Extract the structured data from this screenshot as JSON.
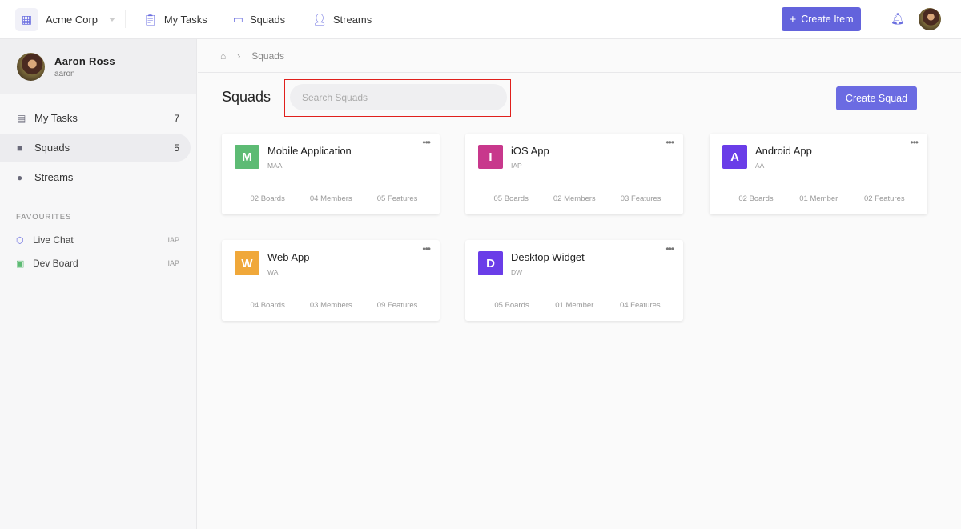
{
  "topbar": {
    "org": "Acme Corp",
    "nav": [
      {
        "label": "My Tasks",
        "icon": "clipboard-icon"
      },
      {
        "label": "Squads",
        "icon": "briefcase-icon"
      },
      {
        "label": "Streams",
        "icon": "streams-icon"
      }
    ],
    "create_item": "Create Item"
  },
  "user": {
    "name": "Aaron Ross",
    "handle": "aaron"
  },
  "sidebar": {
    "items": [
      {
        "label": "My Tasks",
        "count": "7"
      },
      {
        "label": "Squads",
        "count": "5"
      },
      {
        "label": "Streams",
        "count": ""
      }
    ],
    "favourites_heading": "FAVOURITES",
    "favourites": [
      {
        "label": "Live Chat",
        "tag": "IAP"
      },
      {
        "label": "Dev Board",
        "tag": "IAP"
      }
    ]
  },
  "breadcrumb": {
    "current": "Squads"
  },
  "main": {
    "title": "Squads",
    "search_placeholder": "Search Squads",
    "create_squad": "Create Squad"
  },
  "colors": {
    "accent": "#6b6be2"
  },
  "squads": [
    {
      "letter": "M",
      "name": "Mobile Application",
      "code": "MAA",
      "color": "#5dbb74",
      "boards": "02 Boards",
      "members": "04 Members",
      "features": "05 Features"
    },
    {
      "letter": "I",
      "name": "iOS App",
      "code": "IAP",
      "color": "#c8388c",
      "boards": "05 Boards",
      "members": "02 Members",
      "features": "03 Features"
    },
    {
      "letter": "A",
      "name": "Android App",
      "code": "AA",
      "color": "#6a3de8",
      "boards": "02 Boards",
      "members": "01 Member",
      "features": "02 Features"
    },
    {
      "letter": "W",
      "name": "Web App",
      "code": "WA",
      "color": "#f0a83a",
      "boards": "04 Boards",
      "members": "03 Members",
      "features": "09 Features"
    },
    {
      "letter": "D",
      "name": "Desktop Widget",
      "code": "DW",
      "color": "#6a3de8",
      "boards": "05 Boards",
      "members": "01 Member",
      "features": "04 Features"
    }
  ]
}
